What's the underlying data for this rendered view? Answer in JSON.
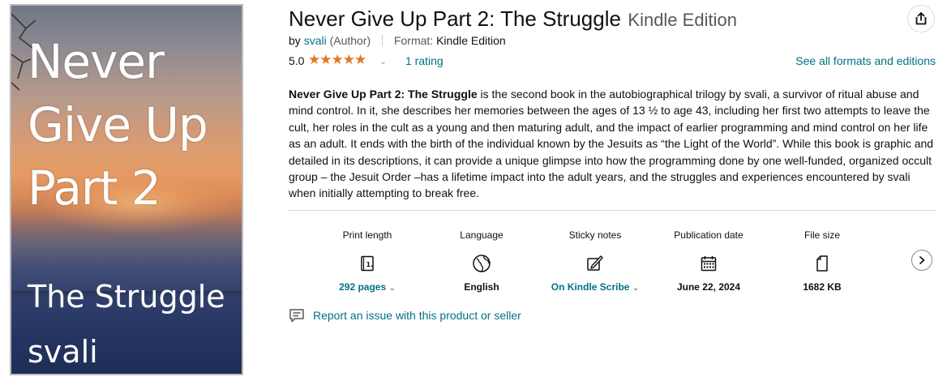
{
  "cover": {
    "title": "Never Give Up Part 2",
    "subtitle": "The Struggle",
    "author": "svali"
  },
  "product": {
    "title": "Never Give Up Part 2: The Struggle",
    "binding": "Kindle Edition",
    "by_prefix": "by",
    "author_name": "svali",
    "author_role": "(Author)",
    "format_label": "Format:",
    "format_value": "Kindle Edition"
  },
  "rating": {
    "score": "5.0",
    "stars": 5,
    "count_label": "1 rating",
    "see_all": "See all formats and editions"
  },
  "description": {
    "bold_lead": "Never Give Up Part 2: The Struggle",
    "body": " is the second book in the autobiographical trilogy by svali, a survivor of ritual abuse and mind control. In it, she describes her memories between the ages of 13 ½ to age 43, including her first two attempts to leave the cult, her roles in the cult as a young and then maturing adult, and the impact of earlier programming and mind control on her life as an adult. It ends with the birth of the individual known by the Jesuits as “the Light of the World”. While this book is graphic and detailed in its descriptions, it can provide a unique glimpse into how the programming done by one well-funded, organized occult group – the Jesuit Order –has a lifetime impact into the adult years, and the struggles and experiences encountered by svali when initially attempting to break free."
  },
  "details": [
    {
      "label": "Print length",
      "value": "292 pages",
      "icon": "book-icon",
      "link": true
    },
    {
      "label": "Language",
      "value": "English",
      "icon": "globe-icon",
      "link": false
    },
    {
      "label": "Sticky notes",
      "value": "On Kindle Scribe",
      "icon": "edit-note-icon",
      "link": true
    },
    {
      "label": "Publication date",
      "value": "June 22, 2024",
      "icon": "calendar-icon",
      "link": false
    },
    {
      "label": "File size",
      "value": "1682 KB",
      "icon": "file-icon",
      "link": false
    }
  ],
  "report": {
    "label": "Report an issue with this product or seller"
  },
  "colors": {
    "link": "#007185",
    "star": "#de7921",
    "text": "#0f1111",
    "muted": "#565959"
  }
}
